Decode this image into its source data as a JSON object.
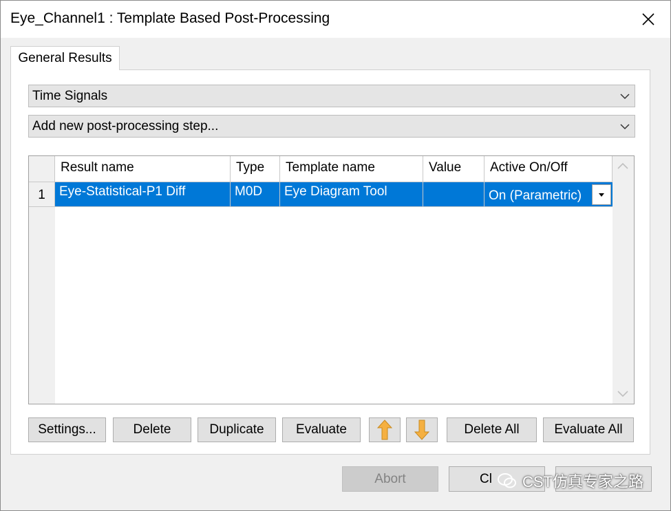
{
  "window": {
    "title": "Eye_Channel1 : Template Based Post-Processing",
    "close_icon": "close-icon"
  },
  "tabs": [
    {
      "label": "General Results",
      "selected": true
    }
  ],
  "result_type_dropdown": {
    "value": "Time Signals"
  },
  "add_step_dropdown": {
    "value": "Add new post-processing step..."
  },
  "table": {
    "columns": [
      "Result name",
      "Type",
      "Template name",
      "Value",
      "Active On/Off"
    ],
    "rows": [
      {
        "index": "1",
        "result_name": "Eye-Statistical-P1 Diff",
        "type": "M0D",
        "template_name": "Eye Diagram Tool",
        "value": "",
        "active": "On (Parametric)",
        "selected": true
      }
    ]
  },
  "buttons": {
    "settings": "Settings...",
    "delete": "Delete",
    "duplicate": "Duplicate",
    "evaluate": "Evaluate",
    "move_up_icon": "arrow-up-icon",
    "move_down_icon": "arrow-down-icon",
    "delete_all": "Delete All",
    "evaluate_all": "Evaluate All"
  },
  "footer": {
    "abort": "Abort",
    "abort_enabled": false,
    "close": "Cl",
    "watermark": "CST仿真专家之路"
  },
  "colors": {
    "selection": "#0078d7",
    "arrow": "#f5b041"
  }
}
